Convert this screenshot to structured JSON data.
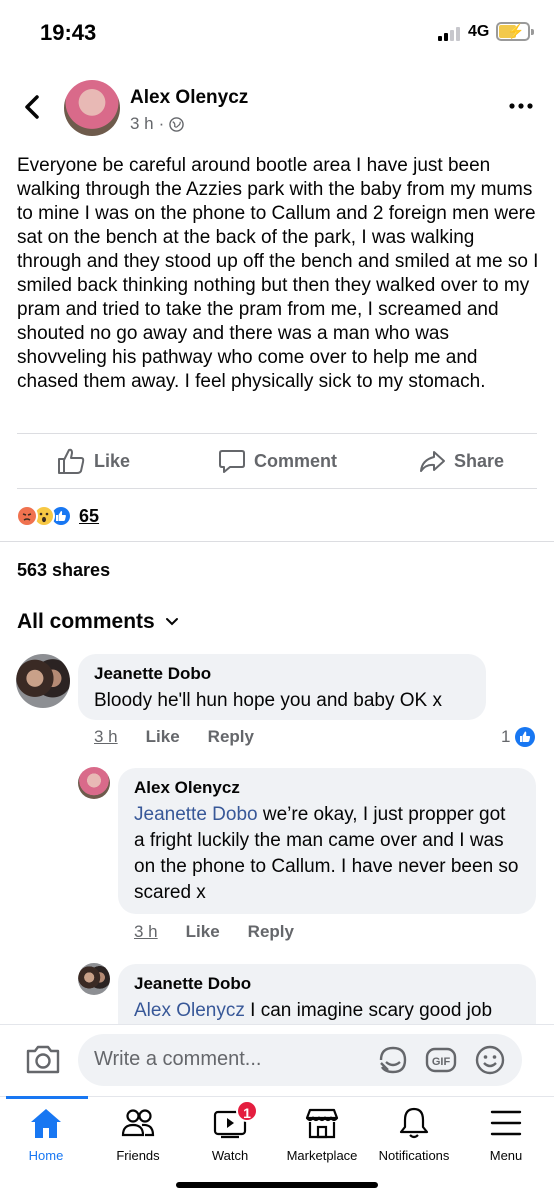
{
  "status_bar": {
    "time": "19:43",
    "network": "4G"
  },
  "post": {
    "author": "Alex Olenycz",
    "time": "3 h",
    "text": "Everyone be careful around bootle area I have just been walking through the Azzies park with the baby from my mums to mine I was on the phone to Callum and 2 foreign men were sat on the bench at the back of the park, I was walking through and they stood up off the bench and smiled at me so I smiled back thinking nothing but then they walked over to my pram and tried to take the pram from me, I screamed and shouted no go away and there was a man who was shovveling his pathway  who come over to help me and chased them away. I feel physically sick to my stomach.",
    "actions": {
      "like": "Like",
      "comment": "Comment",
      "share": "Share"
    },
    "reaction_count": "65",
    "shares": "563 shares",
    "reactions": [
      "angry",
      "wow",
      "like"
    ]
  },
  "comments_header": "All comments",
  "comments": [
    {
      "name": "Jeanette Dobo",
      "text": "Bloody he'll hun hope you and baby OK x",
      "time": "3 h",
      "like": "Like",
      "reply": "Reply",
      "like_count": "1"
    },
    {
      "name": "Alex Olenycz",
      "mention": "Jeanette Dobo",
      "text": " we’re okay, I just propper got a fright luckily the man came over and I was on the phone to Callum. I have never been so scared x",
      "time": "3 h",
      "like": "Like",
      "reply": "Reply"
    },
    {
      "name": "Jeanette Dobo",
      "mention": "Alex Olenycz",
      "text": " I can imagine scary good job"
    }
  ],
  "composer": {
    "placeholder": "Write a comment..."
  },
  "nav": [
    {
      "label": "Home",
      "icon": "home-icon",
      "active": true
    },
    {
      "label": "Friends",
      "icon": "friends-icon"
    },
    {
      "label": "Watch",
      "icon": "watch-icon",
      "badge": "1"
    },
    {
      "label": "Marketplace",
      "icon": "marketplace-icon"
    },
    {
      "label": "Notifications",
      "icon": "bell-icon"
    },
    {
      "label": "Menu",
      "icon": "menu-icon"
    }
  ],
  "colors": {
    "accent": "#1877f2",
    "muted": "#65676b",
    "bubble": "#f0f2f5",
    "badge": "#e41e3f"
  }
}
